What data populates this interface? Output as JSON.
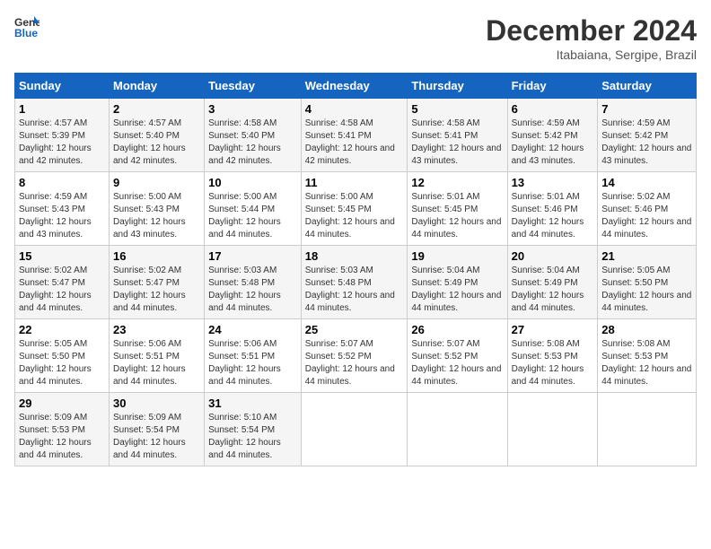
{
  "logo": {
    "line1": "General",
    "line2": "Blue"
  },
  "title": "December 2024",
  "subtitle": "Itabaiana, Sergipe, Brazil",
  "days_of_week": [
    "Sunday",
    "Monday",
    "Tuesday",
    "Wednesday",
    "Thursday",
    "Friday",
    "Saturday"
  ],
  "weeks": [
    [
      {
        "day": "1",
        "sunrise": "4:57 AM",
        "sunset": "5:39 PM",
        "daylight": "12 hours and 42 minutes."
      },
      {
        "day": "2",
        "sunrise": "4:57 AM",
        "sunset": "5:40 PM",
        "daylight": "12 hours and 42 minutes."
      },
      {
        "day": "3",
        "sunrise": "4:58 AM",
        "sunset": "5:40 PM",
        "daylight": "12 hours and 42 minutes."
      },
      {
        "day": "4",
        "sunrise": "4:58 AM",
        "sunset": "5:41 PM",
        "daylight": "12 hours and 42 minutes."
      },
      {
        "day": "5",
        "sunrise": "4:58 AM",
        "sunset": "5:41 PM",
        "daylight": "12 hours and 43 minutes."
      },
      {
        "day": "6",
        "sunrise": "4:59 AM",
        "sunset": "5:42 PM",
        "daylight": "12 hours and 43 minutes."
      },
      {
        "day": "7",
        "sunrise": "4:59 AM",
        "sunset": "5:42 PM",
        "daylight": "12 hours and 43 minutes."
      }
    ],
    [
      {
        "day": "8",
        "sunrise": "4:59 AM",
        "sunset": "5:43 PM",
        "daylight": "12 hours and 43 minutes."
      },
      {
        "day": "9",
        "sunrise": "5:00 AM",
        "sunset": "5:43 PM",
        "daylight": "12 hours and 43 minutes."
      },
      {
        "day": "10",
        "sunrise": "5:00 AM",
        "sunset": "5:44 PM",
        "daylight": "12 hours and 44 minutes."
      },
      {
        "day": "11",
        "sunrise": "5:00 AM",
        "sunset": "5:45 PM",
        "daylight": "12 hours and 44 minutes."
      },
      {
        "day": "12",
        "sunrise": "5:01 AM",
        "sunset": "5:45 PM",
        "daylight": "12 hours and 44 minutes."
      },
      {
        "day": "13",
        "sunrise": "5:01 AM",
        "sunset": "5:46 PM",
        "daylight": "12 hours and 44 minutes."
      },
      {
        "day": "14",
        "sunrise": "5:02 AM",
        "sunset": "5:46 PM",
        "daylight": "12 hours and 44 minutes."
      }
    ],
    [
      {
        "day": "15",
        "sunrise": "5:02 AM",
        "sunset": "5:47 PM",
        "daylight": "12 hours and 44 minutes."
      },
      {
        "day": "16",
        "sunrise": "5:02 AM",
        "sunset": "5:47 PM",
        "daylight": "12 hours and 44 minutes."
      },
      {
        "day": "17",
        "sunrise": "5:03 AM",
        "sunset": "5:48 PM",
        "daylight": "12 hours and 44 minutes."
      },
      {
        "day": "18",
        "sunrise": "5:03 AM",
        "sunset": "5:48 PM",
        "daylight": "12 hours and 44 minutes."
      },
      {
        "day": "19",
        "sunrise": "5:04 AM",
        "sunset": "5:49 PM",
        "daylight": "12 hours and 44 minutes."
      },
      {
        "day": "20",
        "sunrise": "5:04 AM",
        "sunset": "5:49 PM",
        "daylight": "12 hours and 44 minutes."
      },
      {
        "day": "21",
        "sunrise": "5:05 AM",
        "sunset": "5:50 PM",
        "daylight": "12 hours and 44 minutes."
      }
    ],
    [
      {
        "day": "22",
        "sunrise": "5:05 AM",
        "sunset": "5:50 PM",
        "daylight": "12 hours and 44 minutes."
      },
      {
        "day": "23",
        "sunrise": "5:06 AM",
        "sunset": "5:51 PM",
        "daylight": "12 hours and 44 minutes."
      },
      {
        "day": "24",
        "sunrise": "5:06 AM",
        "sunset": "5:51 PM",
        "daylight": "12 hours and 44 minutes."
      },
      {
        "day": "25",
        "sunrise": "5:07 AM",
        "sunset": "5:52 PM",
        "daylight": "12 hours and 44 minutes."
      },
      {
        "day": "26",
        "sunrise": "5:07 AM",
        "sunset": "5:52 PM",
        "daylight": "12 hours and 44 minutes."
      },
      {
        "day": "27",
        "sunrise": "5:08 AM",
        "sunset": "5:53 PM",
        "daylight": "12 hours and 44 minutes."
      },
      {
        "day": "28",
        "sunrise": "5:08 AM",
        "sunset": "5:53 PM",
        "daylight": "12 hours and 44 minutes."
      }
    ],
    [
      {
        "day": "29",
        "sunrise": "5:09 AM",
        "sunset": "5:53 PM",
        "daylight": "12 hours and 44 minutes."
      },
      {
        "day": "30",
        "sunrise": "5:09 AM",
        "sunset": "5:54 PM",
        "daylight": "12 hours and 44 minutes."
      },
      {
        "day": "31",
        "sunrise": "5:10 AM",
        "sunset": "5:54 PM",
        "daylight": "12 hours and 44 minutes."
      },
      null,
      null,
      null,
      null
    ]
  ],
  "labels": {
    "sunrise": "Sunrise:",
    "sunset": "Sunset:",
    "daylight": "Daylight:"
  }
}
